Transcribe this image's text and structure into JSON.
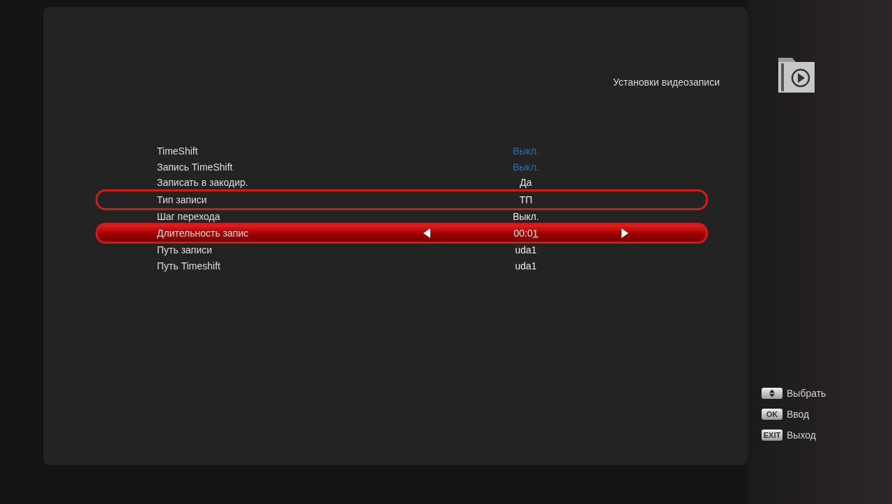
{
  "screen": {
    "title": "Установки видеозаписи"
  },
  "settings": [
    {
      "label": "TimeShift",
      "value": "Выкл.",
      "disabled": true,
      "selected": false,
      "marked": false
    },
    {
      "label": "Запись TimeShift",
      "value": "Выкл.",
      "disabled": true,
      "selected": false,
      "marked": false
    },
    {
      "label": "Записать в закодир.",
      "value": "Да",
      "disabled": false,
      "selected": false,
      "marked": false
    },
    {
      "label": "Тип записи",
      "value": "ТП",
      "disabled": false,
      "selected": false,
      "marked": true
    },
    {
      "label": "Шаг перехода",
      "value": "Выкл.",
      "disabled": false,
      "selected": false,
      "marked": false
    },
    {
      "label": "Длительность запис",
      "value": "00:01",
      "disabled": false,
      "selected": true,
      "marked": true
    },
    {
      "label": "Путь записи",
      "value": "uda1",
      "disabled": false,
      "selected": false,
      "marked": false
    },
    {
      "label": "Путь Timeshift",
      "value": "uda1",
      "disabled": false,
      "selected": false,
      "marked": false
    }
  ],
  "key_hints": [
    {
      "kind": "updown",
      "label": "Выбрать"
    },
    {
      "kind": "ok",
      "key": "OK",
      "label": "Ввод"
    },
    {
      "kind": "exit",
      "key": "EXIT",
      "label": "Выход"
    }
  ]
}
